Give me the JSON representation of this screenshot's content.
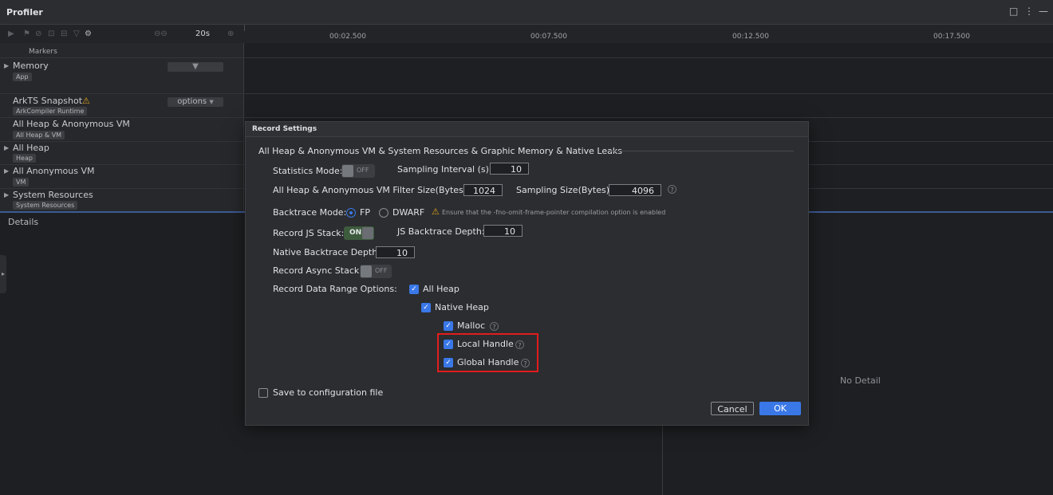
{
  "window": {
    "title": "Profiler",
    "controls": [
      "□",
      "⋮",
      "—"
    ]
  },
  "toolbar": {
    "duration": "20s",
    "zoom_in": "⊕",
    "zoom_out_icons": "⊖⊖"
  },
  "timeline": {
    "ticks": [
      "00:02.500",
      "00:07.500",
      "00:12.500",
      "00:17.500"
    ]
  },
  "tracks": {
    "markers": "Markers",
    "memory": {
      "title": "Memory",
      "tag": "App",
      "select": ""
    },
    "arkts": {
      "title": "ArkTS Snapshot",
      "tag": "ArkCompiler Runtime",
      "select": "options"
    },
    "all_heap_anon": {
      "title": "All Heap & Anonymous VM",
      "tag": "All Heap & VM"
    },
    "all_heap": {
      "title": "All Heap",
      "tag": "Heap"
    },
    "all_anon": {
      "title": "All Anonymous VM",
      "tag": "VM"
    },
    "system": {
      "title": "System Resources",
      "tag": "System Resources"
    }
  },
  "details": {
    "label": "Details",
    "empty": "No Detail"
  },
  "dialog": {
    "title": "Record Settings",
    "section": "All Heap & Anonymous VM & System Resources & Graphic Memory & Native Leaks",
    "statistics_mode": {
      "label": "Statistics Mode:",
      "state": "OFF"
    },
    "sampling_interval": {
      "label": "Sampling Interval (s):",
      "value": "10"
    },
    "filter_size": {
      "label": "All Heap & Anonymous VM Filter Size(Bytes):",
      "value": "1024"
    },
    "sampling_size": {
      "label": "Sampling Size(Bytes):",
      "value": "4096"
    },
    "backtrace": {
      "label": "Backtrace Mode:",
      "fp": "FP",
      "dwarf": "DWARF",
      "warning": "Ensure that the -fno-omit-frame-pointer compilation option is enabled"
    },
    "js_stack": {
      "label": "Record JS Stack:",
      "state": "ON"
    },
    "js_depth": {
      "label": "JS Backtrace Depth:",
      "value": "10"
    },
    "native_depth": {
      "label": "Native Backtrace Depth:",
      "value": "10"
    },
    "async_stack": {
      "label": "Record Async Stack:",
      "state": "OFF"
    },
    "range": {
      "label": "Record Data Range Options:",
      "all_heap": "All Heap",
      "native_heap": "Native Heap",
      "malloc": "Malloc",
      "local_handle": "Local Handle",
      "global_handle": "Global Handle"
    },
    "save_config": "Save to configuration file",
    "cancel": "Cancel",
    "ok": "OK"
  },
  "colors": {
    "accent": "#3a78e8",
    "highlight": "#e21c1c",
    "warning": "#e0a21a"
  }
}
